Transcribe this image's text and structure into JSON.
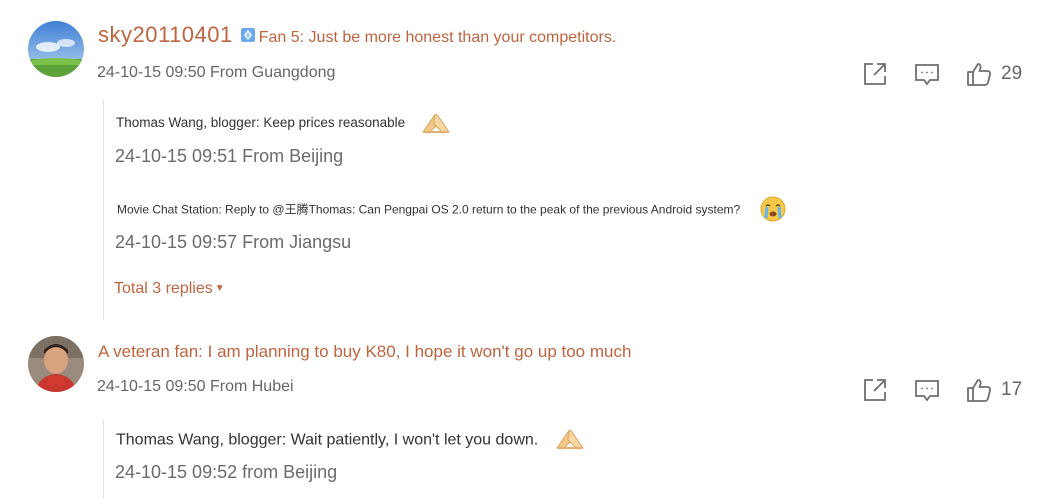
{
  "comments": [
    {
      "username": "sky20110401",
      "badge_icon": "fan-level-diamond-icon",
      "text": "Fan 5: Just be more honest than your competitors.",
      "meta": "24-10-15 09:50 From Guangdong",
      "likes": "29",
      "replies": [
        {
          "text": "Thomas Wang, blogger: Keep prices reasonable",
          "emoji": "folded-hands-emoji",
          "time": "24-10-15 09:51 From Beijing"
        },
        {
          "text": "Movie Chat Station: Reply to @王腾Thomas: Can Pengpai OS 2.0 return to the peak of the previous Android system?",
          "emoji": "crying-face-emoji",
          "time": "24-10-15 09:57 From Jiangsu"
        }
      ],
      "total_replies": "Total 3 replies"
    },
    {
      "username": "",
      "text": "A veteran fan: I am planning to buy K80, I hope it won't go up too much",
      "meta": "24-10-15 09:50 From Hubei",
      "likes": "17",
      "replies": [
        {
          "text": "Thomas Wang, blogger: Wait patiently, I won't let you down.",
          "emoji": "folded-hands-emoji",
          "time": "24-10-15 09:52 from Beijing"
        }
      ]
    }
  ],
  "icons": {
    "share": "share-icon",
    "comment": "comment-icon",
    "like": "thumbs-up-icon"
  },
  "colors": {
    "accent": "#c0643f",
    "meta_text": "#666666",
    "icon": "#6f6f6f",
    "badge": "#6fa8ec"
  }
}
